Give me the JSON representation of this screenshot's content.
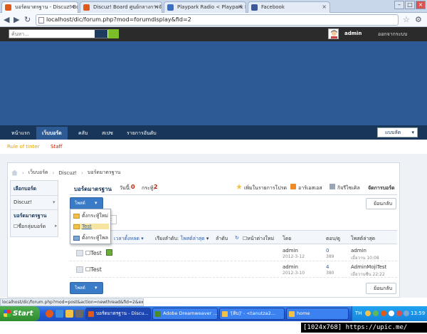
{
  "browser": {
    "tabs": [
      {
        "title": "บอร์ดมาตรฐาน - Discuz! Board",
        "favicon_color": "#e05a1c"
      },
      {
        "title": "Discuz! Board ศูนย์กลางการจัด",
        "favicon_color": "#e05a1c"
      },
      {
        "title": "Playpark Radio < Playpark Mu",
        "favicon_color": "#3b6fc4"
      },
      {
        "title": "Facebook",
        "favicon_color": "#3b5998"
      }
    ],
    "url": "localhost/dic/forum.php?mod=forumdisplay&fid=2",
    "status_url": "localhost/dic/forum.php?mod=post&action=newthread&fid=2&extr"
  },
  "topbar": {
    "search_placeholder": "ค้นหา...",
    "username": "admin",
    "logout": "ออกจากระบบ"
  },
  "nav": {
    "items": [
      "หน้าแรก",
      "เว็บบอร์ด",
      "คลับ",
      "สเปซ",
      "รายการอันดับ"
    ],
    "active_index": 1,
    "lang_select": "แบบลัด"
  },
  "subnav": {
    "rule_link": "Rule of tinter",
    "staff_link": "Staff"
  },
  "breadcrumb": [
    "เว็บบอร์ด",
    "Discuz!",
    "บอร์ดมาตรฐาน"
  ],
  "sidebar": {
    "title": "เลือกบอร์ด",
    "discuz": "Discuz!",
    "forum": "บอร์ดมาตรฐาน",
    "board_select": "☐ชื่อกลุ่มบอร์ด"
  },
  "forum": {
    "name": "บอร์ดมาตรฐาน",
    "today_label": "วันนี้:",
    "today_count": "0",
    "topics_label": "กระทู้:",
    "topics_count": "2",
    "links": [
      "เพิ่มในรายการโปรด",
      "อาร์เอสเอส",
      "กิจรีไซเคิล",
      "จัดการบอร์ด"
    ],
    "post_button": "โพสต์",
    "back_button": "ย้อนกลับ"
  },
  "dropdown": {
    "items": [
      "ตั้งกระทู้ใหม่",
      "Test",
      "ตั้งกระทู้โพล"
    ],
    "highlighted_index": 1
  },
  "filters": {
    "items": [
      "เวลาตั้งหลด",
      "เรียงลำดับ: โพสต์ล่าสุด",
      "ลำดับ",
      "หน้าต่างใหม่"
    ],
    "col_author": "โดย",
    "col_replies": "ตอบ/ดู",
    "col_last": "โพสต์ล่าสุด"
  },
  "threads": [
    {
      "title": "Test",
      "badge": true,
      "author": "admin",
      "date": "2012-3-12",
      "replies": "0",
      "views": "389",
      "last_by": "admin",
      "last_date": "เมื่อวาน 10:08"
    },
    {
      "title": "Test",
      "badge": false,
      "author": "admin",
      "date": "2012-3-10",
      "replies": "4",
      "views": "380",
      "last_by": "AdminMojiTest",
      "last_date": "เมื่อวานซืน 22:22"
    }
  ],
  "taskbar": {
    "start": "Start",
    "tasks": [
      {
        "label": "บอร์ดมาตรฐาน - Discu...",
        "icon_color": "#e05a1c",
        "active": true
      },
      {
        "label": "Adobe Dreamweaver ...",
        "icon_color": "#4a8a2a",
        "active": false
      },
      {
        "label": "'[ดิบ]' - <tanutza2...",
        "icon_color": "#f2c248",
        "active": false
      },
      {
        "label": "home",
        "icon_color": "#f2c248",
        "active": false
      }
    ],
    "lang": "TH",
    "clock": "13:59"
  },
  "overlay_text": "[1024x768] https://upic.me/"
}
